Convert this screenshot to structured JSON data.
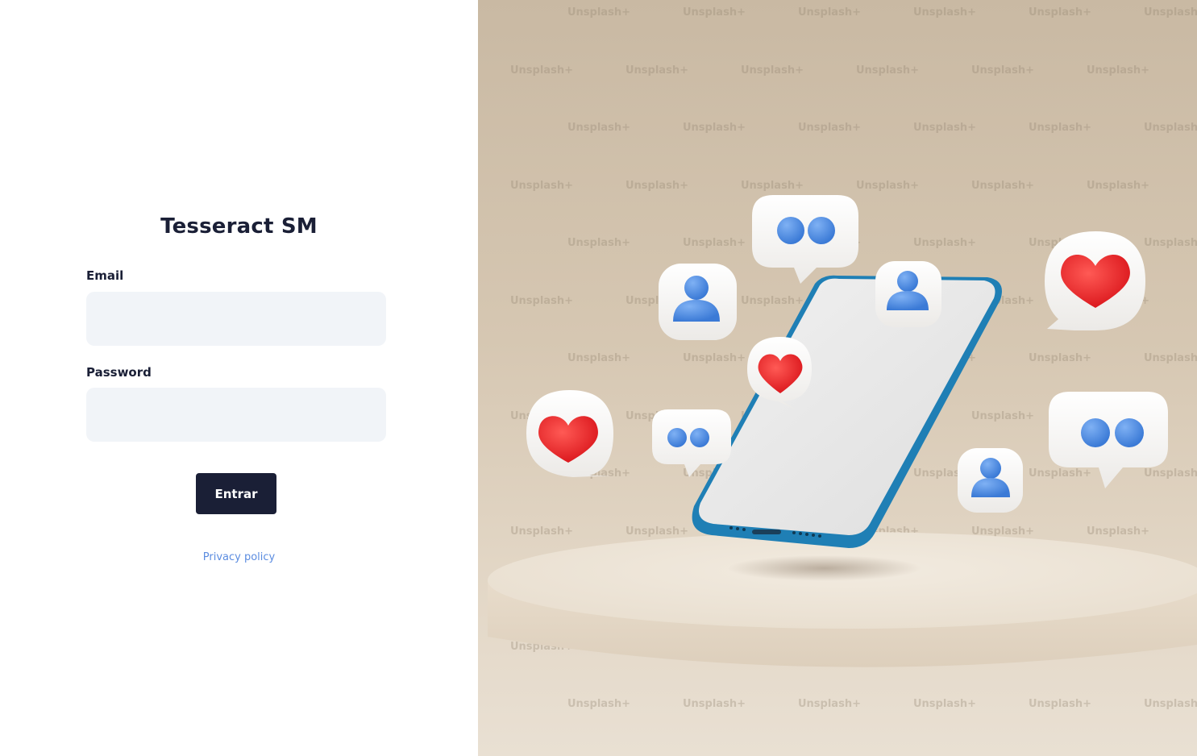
{
  "app": {
    "title": "Tesseract SM"
  },
  "form": {
    "email_label": "Email",
    "email_value": "",
    "password_label": "Password",
    "password_value": "",
    "submit_label": "Entrar",
    "privacy_link": "Privacy policy"
  },
  "hero": {
    "watermark_text": "Unsplash+",
    "icons": [
      "heart-bubble-icon",
      "user-bubble-icon",
      "chat-dots-bubble-icon",
      "smartphone-icon",
      "podium-icon"
    ]
  },
  "colors": {
    "primary": "#1a1f36",
    "input_bg": "#f1f4f8",
    "link": "#5b8ce0",
    "heart": "#e8201f",
    "user_blue": "#4a8ae0",
    "phone_blue": "#1f7fb5"
  }
}
